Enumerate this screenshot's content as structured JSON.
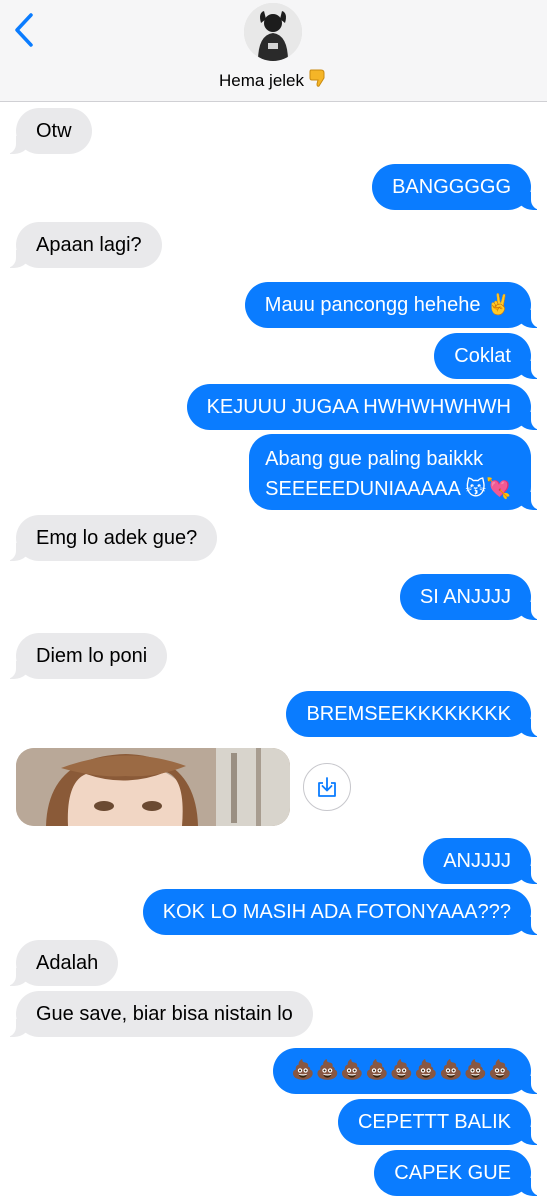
{
  "header": {
    "contact_name": "Hema jelek",
    "back_icon": "chevron-left-icon",
    "thumb_icon": "thumbs-down-emoji"
  },
  "colors": {
    "outgoing": "#0a7cff",
    "incoming": "#e9e9eb"
  },
  "messages": [
    {
      "dir": "in",
      "text": "Otw"
    },
    {
      "dir": "out",
      "text": "BANGGGGG"
    },
    {
      "dir": "in",
      "text": "Apaan lagi?"
    },
    {
      "dir": "out",
      "text": "Mauu pancongg hehehe ✌️"
    },
    {
      "dir": "out",
      "text": "Coklat"
    },
    {
      "dir": "out",
      "text": "KEJUUU JUGAA HWHWHWHWH"
    },
    {
      "dir": "out",
      "line1": "Abang gue paling baikkk",
      "line2": "SEEEEEDUNIAAAAA 😽💘"
    },
    {
      "dir": "in",
      "text": "Emg lo adek gue?"
    },
    {
      "dir": "out",
      "text": "SI ANJJJJ"
    },
    {
      "dir": "in",
      "text": "Diem lo poni"
    },
    {
      "dir": "out",
      "text": "BREMSEEKKKKKKKK"
    },
    {
      "dir": "in",
      "type": "photo",
      "save_icon": "save-download-icon"
    },
    {
      "dir": "out",
      "text": "ANJJJJ"
    },
    {
      "dir": "out",
      "text": "KOK LO MASIH ADA FOTONYAAA???"
    },
    {
      "dir": "in",
      "text": "Adalah"
    },
    {
      "dir": "in",
      "text": "Gue save, biar bisa nistain lo"
    },
    {
      "dir": "out",
      "text": "💩💩💩💩💩💩💩💩💩"
    },
    {
      "dir": "out",
      "text": "CEPETTT BALIK"
    },
    {
      "dir": "out",
      "text": "CAPEK GUE"
    }
  ]
}
